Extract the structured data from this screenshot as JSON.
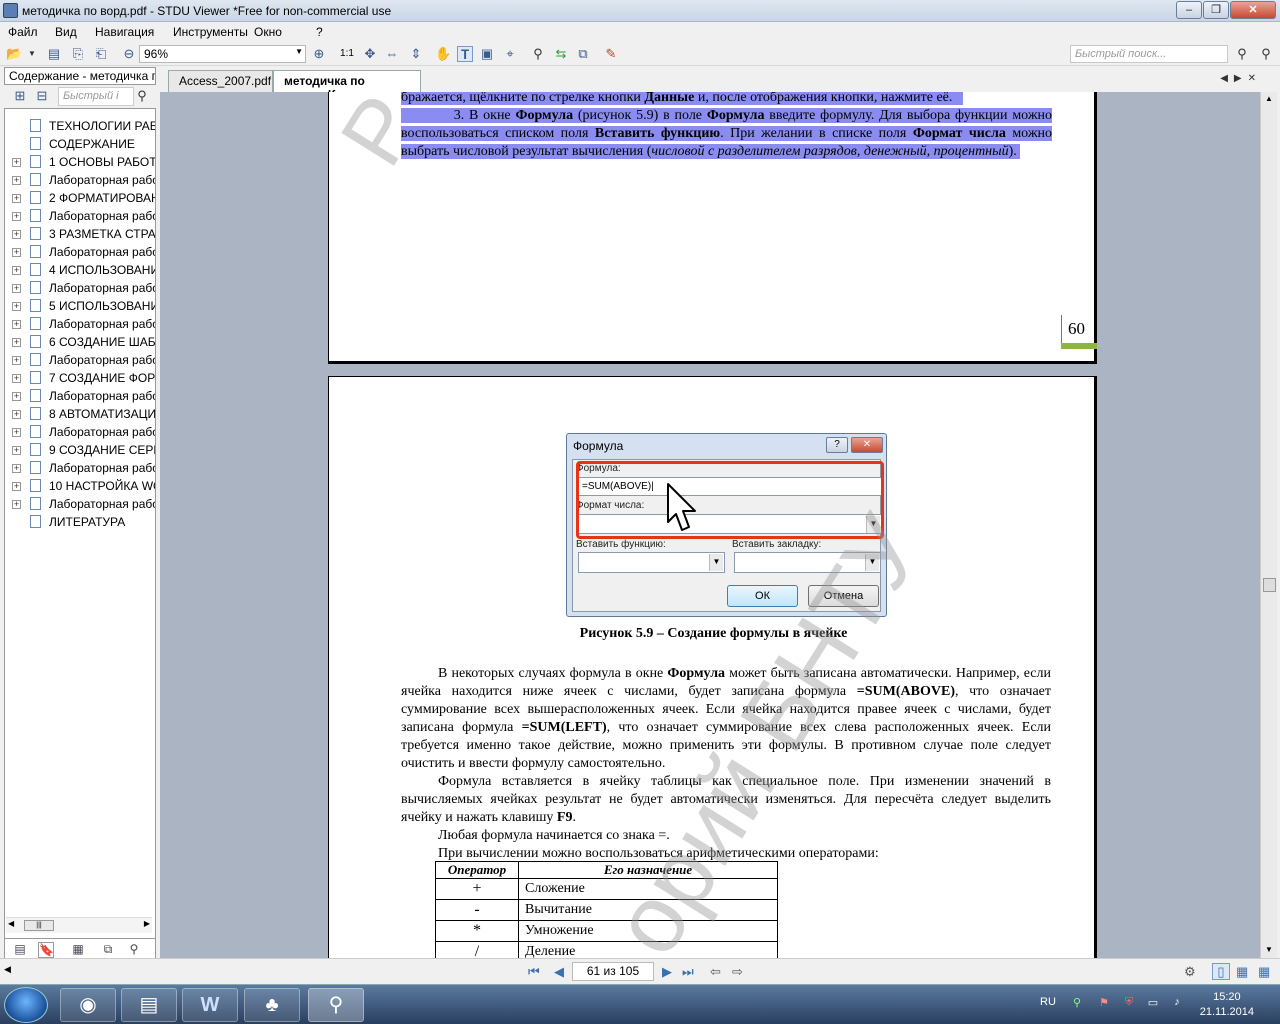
{
  "window": {
    "title": "методичка по ворд.pdf - STDU Viewer *Free for non-commercial use"
  },
  "menu": [
    "Файл",
    "Вид",
    "Навигация",
    "Инструменты",
    "Окно",
    "?"
  ],
  "toolbar": {
    "zoom": "96%",
    "zoom_1to1": "1:1",
    "search_placeholder": "Быстрый поиск..."
  },
  "sidebar": {
    "title": "Содержание - методичка п",
    "search_placeholder": "Быстрый і",
    "items": [
      {
        "label": "ТЕХНОЛОГИИ РАБ",
        "expandable": false
      },
      {
        "label": "СОДЕРЖАНИЕ",
        "expandable": false
      },
      {
        "label": "1 ОСНОВЫ РАБОТЫ",
        "expandable": true
      },
      {
        "label": "Лабораторная рабо",
        "expandable": true
      },
      {
        "label": "2 ФОРМАТИРОВАН",
        "expandable": true
      },
      {
        "label": "Лабораторная рабо",
        "expandable": true
      },
      {
        "label": "3 РАЗМЕТКА СТРА",
        "expandable": true
      },
      {
        "label": "Лабораторная рабо",
        "expandable": true
      },
      {
        "label": "4 ИСПОЛЬЗОВАНИ",
        "expandable": true
      },
      {
        "label": "Лабораторная рабо",
        "expandable": true
      },
      {
        "label": "5 ИСПОЛЬЗОВАНИ",
        "expandable": true
      },
      {
        "label": "Лабораторная рабо",
        "expandable": true
      },
      {
        "label": "6 СОЗДАНИЕ ШАБЛ",
        "expandable": true
      },
      {
        "label": "Лабораторная рабо",
        "expandable": true
      },
      {
        "label": "7 СОЗДАНИЕ ФОРМ",
        "expandable": true
      },
      {
        "label": "Лабораторная рабо",
        "expandable": true
      },
      {
        "label": "8 АВТОМАТИЗАЦИ",
        "expandable": true
      },
      {
        "label": "Лабораторная рабо",
        "expandable": true
      },
      {
        "label": "9 СОЗДАНИЕ СЕРИ",
        "expandable": true
      },
      {
        "label": "Лабораторная рабо",
        "expandable": true
      },
      {
        "label": "10 НАСТРОЙКА WO",
        "expandable": true
      },
      {
        "label": "Лабораторная рабо",
        "expandable": true
      },
      {
        "label": "ЛИТЕРАТУРА",
        "expandable": false
      }
    ]
  },
  "tabs": [
    {
      "label": "Access_2007.pdf",
      "active": false
    },
    {
      "label": "методичка по ворд.pdf",
      "active": true
    }
  ],
  "page1": {
    "line1": "бражается, щёлкните по стрелке кнопки ",
    "line1_b": "Данные",
    "line1_end": " и, после отображения кнопки, нажмите её.",
    "p3_a": "3. В окне ",
    "p3_b1": "Формула",
    "p3_c": " (рисунок 5.9) в поле ",
    "p3_b2": "Формула",
    "p3_d": " введите формулу. Для выбора функции можно воспользоваться списком поля ",
    "p3_b3": "Вставить функцию",
    "p3_e": ". При желании в списке поля ",
    "p3_b4": "Формат числа",
    "p3_f": " можно выбрать числовой результат вычисления (",
    "p3_i": "числовой с разделителем разрядов, денежный, процентный",
    "p3_g": ").",
    "page_number": "60"
  },
  "dialog": {
    "title": "Формула",
    "help": "?",
    "close": "✕",
    "formula_label": "Формула:",
    "formula_value": "=SUM(ABOVE)",
    "number_format_label": "Формат числа:",
    "insert_function_label": "Вставить функцию:",
    "insert_bookmark_label": "Вставить закладку:",
    "ok": "ОК",
    "cancel": "Отмена"
  },
  "page2": {
    "caption": "Рисунок 5.9 – Создание формулы в ячейке",
    "para1_a": "В некоторых случаях формула в окне ",
    "para1_b": "Формула",
    "para1_c": " может быть записана автоматически. Например, если ячейка находится ниже ячеек с числами, будет записана формула ",
    "para1_d": "=SUM(ABOVE)",
    "para1_e": ", что означает суммирование всех вышерасположенных ячеек. Если ячейка находится правее ячеек с числами, будет записана формула ",
    "para1_f": "=SUM(LEFT)",
    "para1_g": ", что означает суммирование всех слева расположенных ячеек. Если требуется именно такое действие, можно применить эти формулы. В противном случае поле следует очистить и ввести формулу самостоятельно.",
    "para2_a": "Формула вставляется в ячейку таблицы как специальное поле. При изменении значений в вычисляемых ячейках результат не будет автоматически изменяться. Для пересчёта следует выделить ячейку и нажать клавишу ",
    "para2_b": "F9",
    "para2_c": ".",
    "para3": "Любая формула начинается со знака =.",
    "para4": "При вычислении можно воспользоваться арифметическими операторами:",
    "table_headers": [
      "Оператор",
      "Его назначение"
    ],
    "table_rows": [
      [
        "+",
        "Сложение"
      ],
      [
        "-",
        "Вычитание"
      ],
      [
        "*",
        "Умножение"
      ],
      [
        "/",
        "Деление"
      ]
    ]
  },
  "watermark": {
    "text_top": "Р",
    "text_main": "орий БНТУ"
  },
  "navigation": {
    "page_indicator": "61 из 105"
  },
  "taskbar": {
    "lang": "RU",
    "time": "15:20",
    "date": "21.11.2014"
  }
}
